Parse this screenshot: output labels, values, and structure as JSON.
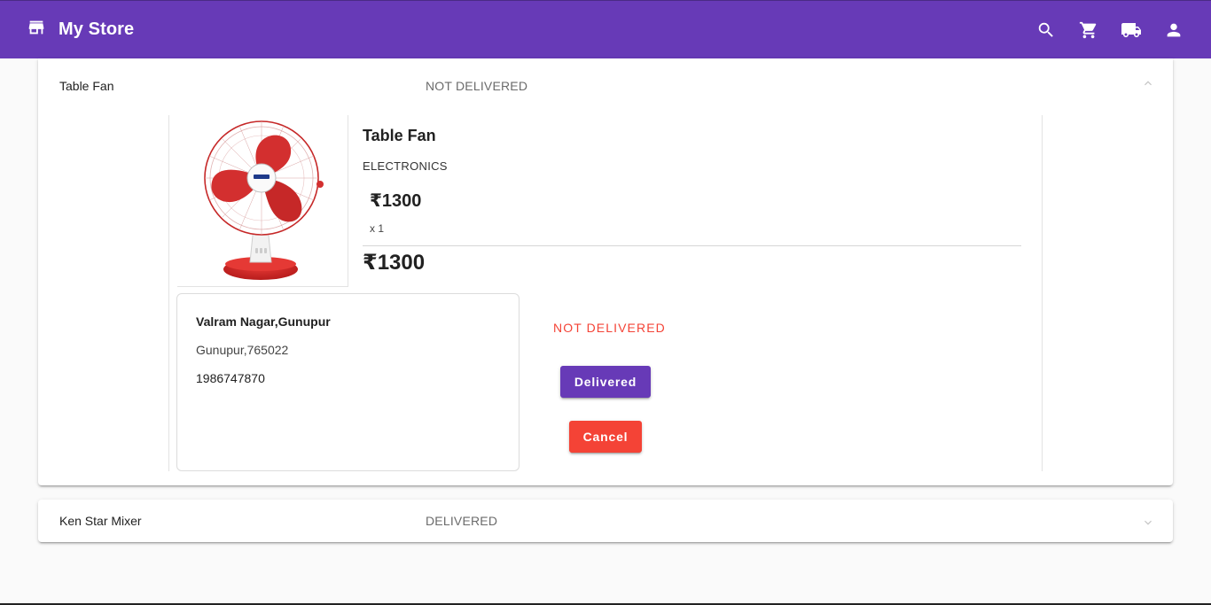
{
  "app": {
    "title": "My Store"
  },
  "toolbar": {
    "icons": [
      "search-icon",
      "cart-icon",
      "truck-icon",
      "person-icon"
    ]
  },
  "orders": [
    {
      "title": "Table Fan",
      "status": "NOT DELIVERED",
      "expanded": true,
      "product": {
        "name": "Table Fan",
        "category": "ELECTRONICS",
        "price": "₹1300",
        "quantity": "x 1",
        "total": "₹1300"
      },
      "address": {
        "line1": "Valram Nagar,Gunupur",
        "line2": "Gunupur,765022",
        "phone": "1986747870"
      },
      "delivery_status": "NOT DELIVERED",
      "actions": {
        "delivered": "Delivered",
        "cancel": "Cancel"
      }
    },
    {
      "title": "Ken Star Mixer",
      "status": "DELIVERED",
      "expanded": false
    }
  ],
  "colors": {
    "primary": "#673ab7",
    "warn": "#f44336"
  }
}
